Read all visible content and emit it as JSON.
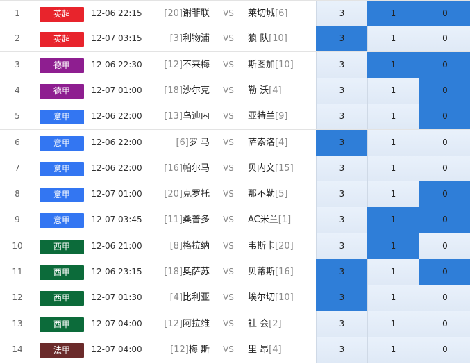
{
  "colors": {
    "英超": "#e8242c",
    "德甲": "#8e1e90",
    "意甲": "#3376f2",
    "西甲": "#0c6b3a",
    "法甲": "#6b2b2b",
    "selected": "#2f7ed8",
    "unselected": "#e6eef9"
  },
  "rows": [
    {
      "idx": "1",
      "league": "英超",
      "time": "12-06 22:15",
      "home_rank": "[20]",
      "home": "谢菲联",
      "vs": "VS",
      "away": "莱切城",
      "away_rank": "[6]",
      "odds": [
        "3",
        "1",
        "0"
      ],
      "selected": [
        false,
        true,
        true
      ]
    },
    {
      "idx": "2",
      "league": "英超",
      "time": "12-07 03:15",
      "home_rank": "[3]",
      "home": "利物浦",
      "vs": "VS",
      "away": "狼 队",
      "away_rank": "[10]",
      "odds": [
        "3",
        "1",
        "0"
      ],
      "selected": [
        true,
        false,
        false
      ]
    },
    {
      "idx": "3",
      "league": "德甲",
      "time": "12-06 22:30",
      "home_rank": "[12]",
      "home": "不来梅",
      "vs": "VS",
      "away": "斯图加",
      "away_rank": "[10]",
      "odds": [
        "3",
        "1",
        "0"
      ],
      "selected": [
        false,
        true,
        true
      ]
    },
    {
      "idx": "4",
      "league": "德甲",
      "time": "12-07 01:00",
      "home_rank": "[18]",
      "home": "沙尔克",
      "vs": "VS",
      "away": "勒 沃",
      "away_rank": "[4]",
      "odds": [
        "3",
        "1",
        "0"
      ],
      "selected": [
        false,
        false,
        true
      ]
    },
    {
      "idx": "5",
      "league": "意甲",
      "time": "12-06 22:00",
      "home_rank": "[13]",
      "home": "乌迪内",
      "vs": "VS",
      "away": "亚特兰",
      "away_rank": "[9]",
      "odds": [
        "3",
        "1",
        "0"
      ],
      "selected": [
        false,
        false,
        true
      ]
    },
    {
      "idx": "6",
      "league": "意甲",
      "time": "12-06 22:00",
      "home_rank": "[6]",
      "home": "罗 马",
      "vs": "VS",
      "away": "萨索洛",
      "away_rank": "[4]",
      "odds": [
        "3",
        "1",
        "0"
      ],
      "selected": [
        true,
        false,
        false
      ]
    },
    {
      "idx": "7",
      "league": "意甲",
      "time": "12-06 22:00",
      "home_rank": "[16]",
      "home": "帕尔马",
      "vs": "VS",
      "away": "贝内文",
      "away_rank": "[15]",
      "odds": [
        "3",
        "1",
        "0"
      ],
      "selected": [
        false,
        false,
        false
      ]
    },
    {
      "idx": "8",
      "league": "意甲",
      "time": "12-07 01:00",
      "home_rank": "[20]",
      "home": "克罗托",
      "vs": "VS",
      "away": "那不勒",
      "away_rank": "[5]",
      "odds": [
        "3",
        "1",
        "0"
      ],
      "selected": [
        false,
        false,
        true
      ]
    },
    {
      "idx": "9",
      "league": "意甲",
      "time": "12-07 03:45",
      "home_rank": "[11]",
      "home": "桑普多",
      "vs": "VS",
      "away": "AC米兰",
      "away_rank": "[1]",
      "odds": [
        "3",
        "1",
        "0"
      ],
      "selected": [
        false,
        true,
        true
      ]
    },
    {
      "idx": "10",
      "league": "西甲",
      "time": "12-06 21:00",
      "home_rank": "[8]",
      "home": "格拉纳",
      "vs": "VS",
      "away": "韦斯卡",
      "away_rank": "[20]",
      "odds": [
        "3",
        "1",
        "0"
      ],
      "selected": [
        false,
        true,
        false
      ]
    },
    {
      "idx": "11",
      "league": "西甲",
      "time": "12-06 23:15",
      "home_rank": "[18]",
      "home": "奥萨苏",
      "vs": "VS",
      "away": "贝蒂斯",
      "away_rank": "[16]",
      "odds": [
        "3",
        "1",
        "0"
      ],
      "selected": [
        true,
        false,
        true
      ]
    },
    {
      "idx": "12",
      "league": "西甲",
      "time": "12-07 01:30",
      "home_rank": "[4]",
      "home": "比利亚",
      "vs": "VS",
      "away": "埃尔切",
      "away_rank": "[10]",
      "odds": [
        "3",
        "1",
        "0"
      ],
      "selected": [
        true,
        false,
        false
      ]
    },
    {
      "idx": "13",
      "league": "西甲",
      "time": "12-07 04:00",
      "home_rank": "[12]",
      "home": "阿拉维",
      "vs": "VS",
      "away": "社 会",
      "away_rank": "[2]",
      "odds": [
        "3",
        "1",
        "0"
      ],
      "selected": [
        false,
        false,
        false
      ]
    },
    {
      "idx": "14",
      "league": "法甲",
      "time": "12-07 04:00",
      "home_rank": "[12]",
      "home": "梅 斯",
      "vs": "VS",
      "away": "里 昂",
      "away_rank": "[4]",
      "odds": [
        "3",
        "1",
        "0"
      ],
      "selected": [
        false,
        false,
        false
      ]
    }
  ]
}
